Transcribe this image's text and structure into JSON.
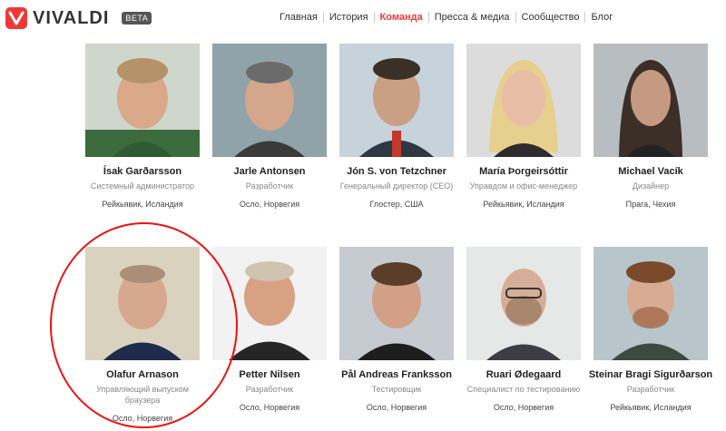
{
  "header": {
    "logo_text": "VIVALDI",
    "beta_label": "BETA",
    "nav": [
      {
        "label": "Главная"
      },
      {
        "label": "История"
      },
      {
        "label": "Команда"
      },
      {
        "label": "Пресса & медиа"
      },
      {
        "label": "Сообщество"
      },
      {
        "label": "Блог"
      }
    ]
  },
  "team": [
    {
      "name": "Ísak Garðarsson",
      "role": "Системный администратор",
      "location": "Рейкьявик, Исландия"
    },
    {
      "name": "Jarle Antonsen",
      "role": "Разработчик",
      "location": "Осло, Норвегия"
    },
    {
      "name": "Jón S. von Tetzchner",
      "role": "Генеральный директор (CEO)",
      "location": "Глостер, США"
    },
    {
      "name": "María Þorgeirsóttir",
      "role": "Управдом и офис-менеджер",
      "location": "Рейкьявик, Исландия"
    },
    {
      "name": "Michael Vacík",
      "role": "Дизайнер",
      "location": "Прага, Чехия"
    },
    {
      "name": "Olafur Arnason",
      "role": "Управляющий выпуском браузера",
      "location": "Осло, Норвегия"
    },
    {
      "name": "Petter Nilsen",
      "role": "Разработчик",
      "location": "Осло, Норвегия"
    },
    {
      "name": "Pål Andreas Franksson",
      "role": "Тестировщик",
      "location": "Осло, Норвегия"
    },
    {
      "name": "Ruari Ødegaard",
      "role": "Специалист по тестированию",
      "location": "Осло, Норвегия"
    },
    {
      "name": "Steinar Bragi Sigurðarson",
      "role": "Разработчик",
      "location": "Рейкьявик, Исландия"
    }
  ],
  "colors": {
    "accent": "#ef3939",
    "highlight": "#e11111"
  }
}
